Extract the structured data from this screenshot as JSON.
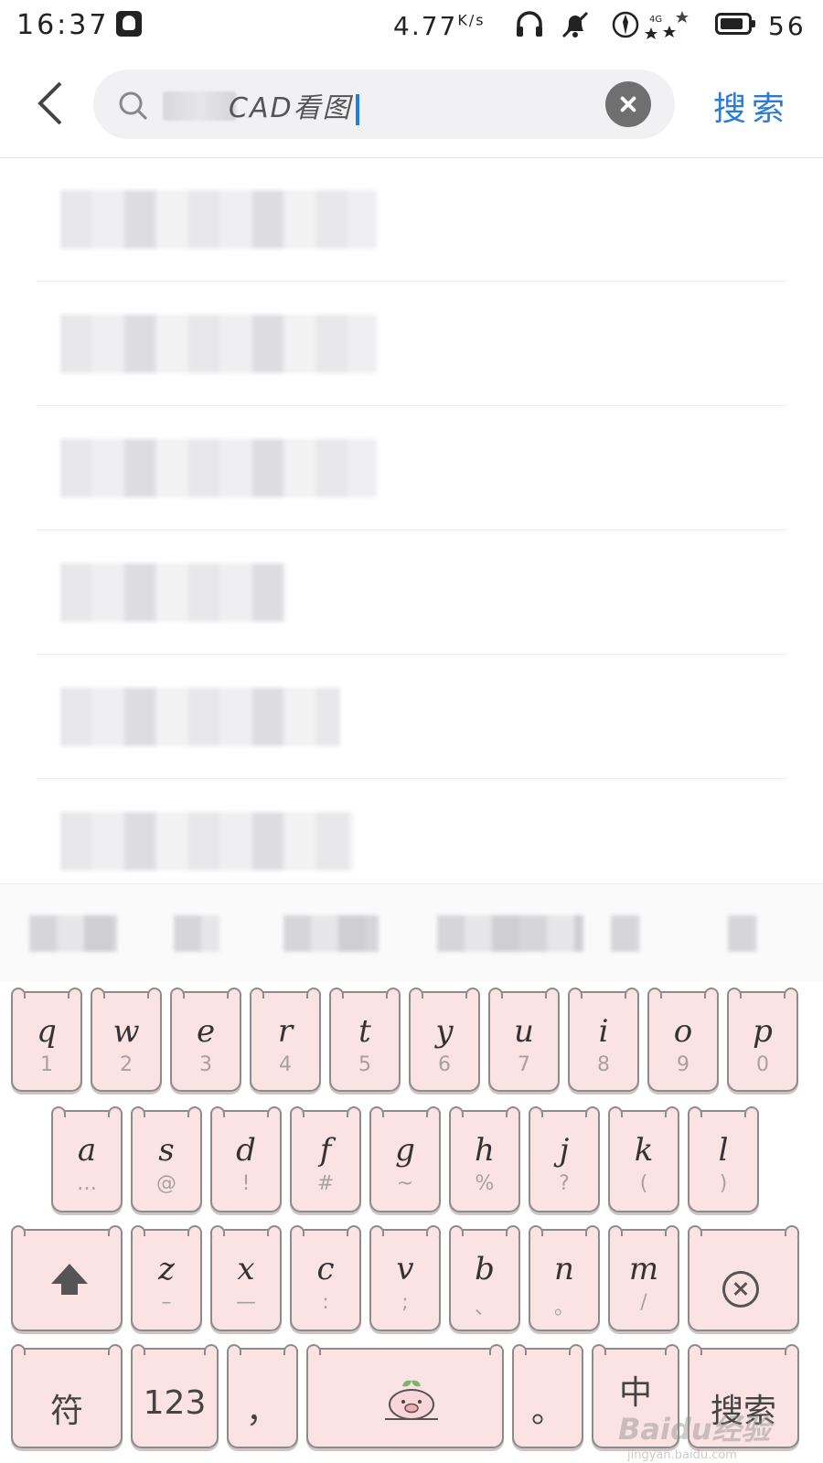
{
  "status": {
    "time": "16:37",
    "speed": "4.77",
    "speed_unit": "K/s",
    "battery": "56"
  },
  "search": {
    "query": "CAD看图",
    "action_label": "搜索"
  },
  "suggestions": [
    {
      "label": ""
    },
    {
      "label": ""
    },
    {
      "label": ""
    },
    {
      "label": ""
    },
    {
      "label": ""
    },
    {
      "label": ""
    }
  ],
  "keyboard": {
    "row1": [
      {
        "key": "q",
        "sub": "1"
      },
      {
        "key": "w",
        "sub": "2"
      },
      {
        "key": "e",
        "sub": "3"
      },
      {
        "key": "r",
        "sub": "4"
      },
      {
        "key": "t",
        "sub": "5"
      },
      {
        "key": "y",
        "sub": "6"
      },
      {
        "key": "u",
        "sub": "7"
      },
      {
        "key": "i",
        "sub": "8"
      },
      {
        "key": "o",
        "sub": "9"
      },
      {
        "key": "p",
        "sub": "0"
      }
    ],
    "row2": [
      {
        "key": "a",
        "sub": "…"
      },
      {
        "key": "s",
        "sub": "@"
      },
      {
        "key": "d",
        "sub": "!"
      },
      {
        "key": "f",
        "sub": "#"
      },
      {
        "key": "g",
        "sub": "~"
      },
      {
        "key": "h",
        "sub": "%"
      },
      {
        "key": "j",
        "sub": "?"
      },
      {
        "key": "k",
        "sub": "("
      },
      {
        "key": "l",
        "sub": ")"
      }
    ],
    "row3": [
      {
        "key": "z",
        "sub": "–"
      },
      {
        "key": "x",
        "sub": "—"
      },
      {
        "key": "c",
        "sub": ":"
      },
      {
        "key": "v",
        "sub": ";"
      },
      {
        "key": "b",
        "sub": "、"
      },
      {
        "key": "n",
        "sub": "。"
      },
      {
        "key": "m",
        "sub": "/"
      }
    ],
    "symbols_label": "符",
    "numbers_label": "123",
    "comma_label": "，",
    "period_label": "。",
    "lang_label": "中",
    "search_label": "搜索"
  },
  "watermark": {
    "brand": "Baidu经验",
    "url": "jingyan.baidu.com"
  }
}
